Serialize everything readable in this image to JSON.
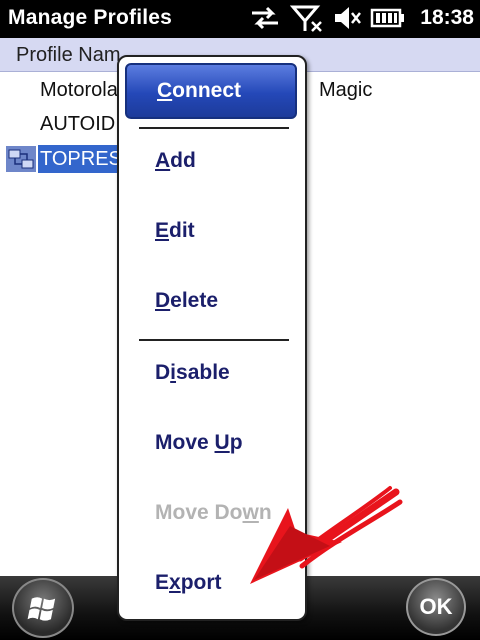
{
  "statusbar": {
    "title": "Manage Profiles",
    "time": "18:38"
  },
  "list": {
    "column_header": "Profile Nam",
    "rows": [
      {
        "text": "Motorola",
        "text2": "Magic"
      },
      {
        "text": "AUTOID"
      },
      {
        "text": "TOPRES"
      }
    ]
  },
  "menu": {
    "connect_pre": "",
    "connect_ul": "C",
    "connect_post": "onnect",
    "items": [
      {
        "pre": "",
        "ul": "A",
        "post": "dd"
      },
      {
        "pre": "",
        "ul": "E",
        "post": "dit"
      },
      {
        "pre": "",
        "ul": "D",
        "post": "elete"
      },
      {
        "pre": "D",
        "ul": "i",
        "post": "sable"
      },
      {
        "pre": "Move ",
        "ul": "U",
        "post": "p"
      },
      {
        "pre": "Move Do",
        "ul": "w",
        "post": "n"
      },
      {
        "pre": "E",
        "ul": "x",
        "post": "port"
      }
    ]
  },
  "softkeys": {
    "ok": "OK"
  },
  "colors": {
    "selection": "#3366cc",
    "menu_text": "#1b1f6b",
    "disabled_text": "#b3b3b3",
    "annotation": "#e8141c"
  }
}
